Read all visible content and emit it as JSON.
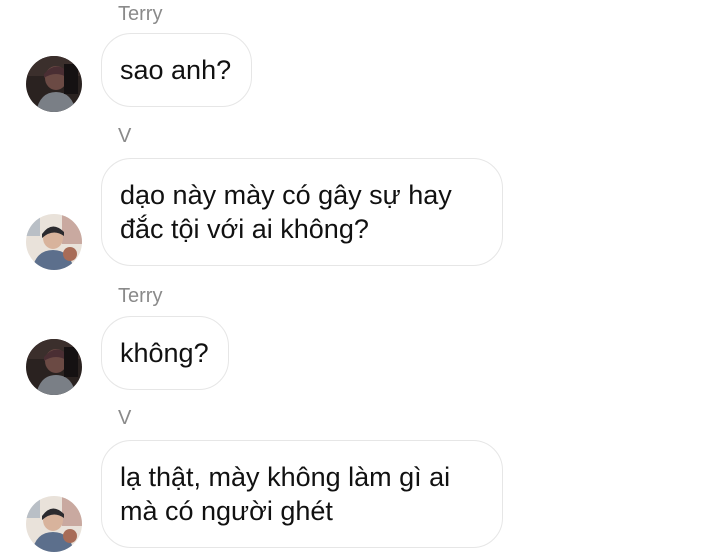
{
  "messages": [
    {
      "sender": "Terry",
      "text": "sao anh?",
      "avatar_icon": "terry-avatar"
    },
    {
      "sender": "V",
      "text": "dạo này mày có gây sự hay\nđắc tội với ai không?",
      "avatar_icon": "v-avatar"
    },
    {
      "sender": "Terry",
      "text": "không?",
      "avatar_icon": "terry-avatar"
    },
    {
      "sender": "V",
      "text": "lạ thật, mày không làm gì ai\nmà có người ghét",
      "avatar_icon": "v-avatar"
    }
  ],
  "colors": {
    "background": "#ffffff",
    "bubble_border": "#e6e6e6",
    "sender_name": "#8a8a8a",
    "message_text": "#111111"
  }
}
